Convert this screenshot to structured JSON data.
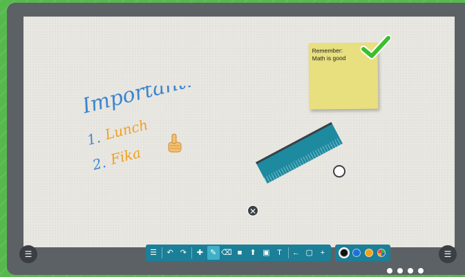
{
  "sticky_note": {
    "line1": "Remember:",
    "line2": "Math is good",
    "color": "#e8df7e"
  },
  "handwriting": {
    "title": "Important!",
    "item1_num": "1.",
    "item1_text": "Lunch",
    "item2_num": "2.",
    "item2_text": "Fika",
    "title_color": "#3a86d0",
    "item_color": "#f0a020"
  },
  "ruler": {
    "close_icon": "close-icon",
    "handle_icon": "rotate-handle"
  },
  "menu_button_left": {
    "label": "☰"
  },
  "menu_button_right": {
    "label": "☰"
  },
  "toolbar": {
    "items": [
      {
        "name": "menu-icon",
        "glyph": "☰"
      },
      {
        "name": "undo-icon",
        "glyph": "↶"
      },
      {
        "name": "redo-icon",
        "glyph": "↷"
      },
      {
        "name": "move-icon",
        "glyph": "✚"
      },
      {
        "name": "pen-icon",
        "glyph": "✎"
      },
      {
        "name": "eraser-icon",
        "glyph": "⌫"
      },
      {
        "name": "sticky-note-icon",
        "glyph": "■"
      },
      {
        "name": "stamp-icon",
        "glyph": "⬆"
      },
      {
        "name": "image-icon",
        "glyph": "▣"
      },
      {
        "name": "text-icon",
        "glyph": "T"
      },
      {
        "name": "back-icon",
        "glyph": "←"
      },
      {
        "name": "page-icon",
        "glyph": "▢"
      },
      {
        "name": "add-icon",
        "glyph": "+"
      }
    ]
  },
  "palette": {
    "colors": [
      "#111111",
      "#1f6fd8",
      "#f2a21a",
      "#3cb043"
    ]
  },
  "page_dots": {
    "count": 4,
    "active": 0
  }
}
